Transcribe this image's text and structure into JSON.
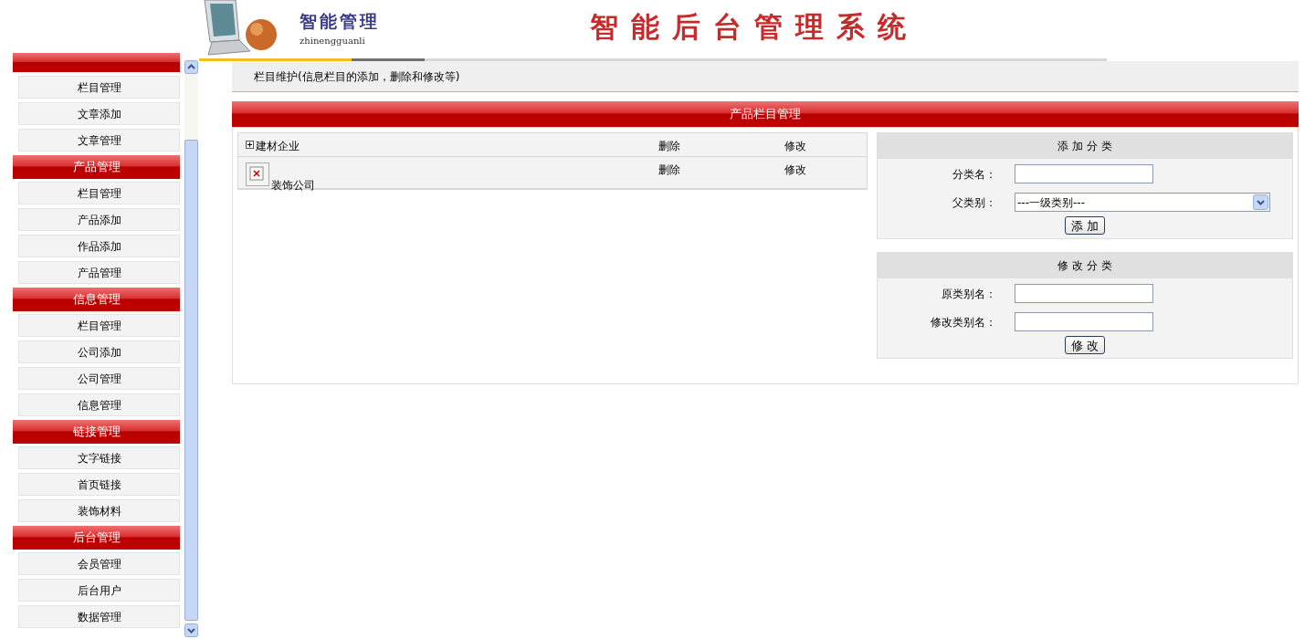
{
  "header": {
    "logo_title": "智能管理",
    "logo_subtitle": "zhinengguanli",
    "system_title": "智能后台管理系统"
  },
  "sidebar": {
    "groups": [
      {
        "items": [
          "栏目管理",
          "文章添加",
          "文章管理"
        ]
      },
      {
        "title": "产品管理",
        "items": [
          "栏目管理",
          "产品添加",
          "作品添加",
          "产品管理"
        ]
      },
      {
        "title": "信息管理",
        "items": [
          "栏目管理",
          "公司添加",
          "公司管理",
          "信息管理"
        ]
      },
      {
        "title": "链接管理",
        "items": [
          "文字链接",
          "首页链接",
          "装饰材料"
        ]
      },
      {
        "title": "后台管理",
        "items": [
          "会员管理",
          "后台用户",
          "数据管理"
        ]
      }
    ]
  },
  "breadcrumb": "栏目维护(信息栏目的添加，删除和修改等)",
  "panel_title": "产品栏目管理",
  "categories": [
    {
      "kind": "expandable",
      "name": "建材企业",
      "actions": [
        "删除",
        "修改"
      ]
    },
    {
      "kind": "image",
      "name": "装饰公司",
      "actions": [
        "删除",
        "修改"
      ]
    }
  ],
  "forms": [
    {
      "title": "添 加 分 类",
      "fields": [
        {
          "kind": "text",
          "label": "分类名："
        },
        {
          "kind": "select",
          "label": "父类别：",
          "value": "---一级类别---"
        }
      ],
      "button": "添 加"
    },
    {
      "title": "修 改 分 类",
      "fields": [
        {
          "kind": "text",
          "label": "原类别名："
        },
        {
          "kind": "text",
          "label": "修改类别名："
        }
      ],
      "button": "修 改"
    }
  ]
}
